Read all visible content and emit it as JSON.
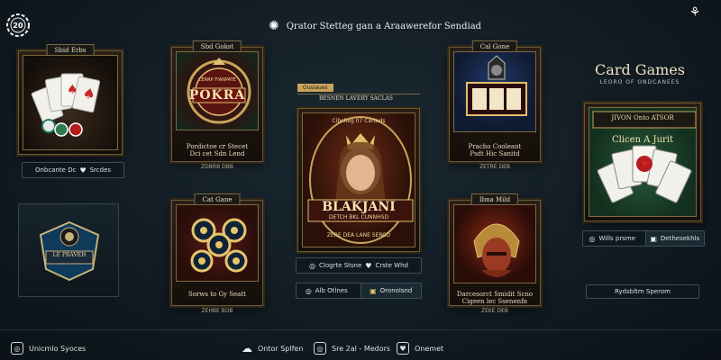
{
  "header": {
    "logo_badge_text": "20",
    "title": "Qrator Stetteg gan a Araawerefor Sendiad"
  },
  "cards_left": {
    "top": {
      "tag": "Sbid Erbs",
      "button_left": "Onbcante Dc",
      "button_right": "Srcdes"
    },
    "bottom": {
      "badge_text": "LE PRAVEH"
    }
  },
  "cards_col2": {
    "poker": {
      "tag": "Sbd Gokst",
      "title": "POKRA",
      "subtitle": "CERRP FIANPATE",
      "caption_line1": "Pordictoe cr Stecet",
      "caption_line2": "Dci cet Sdn Lend",
      "sub": "ZDBRB DBB"
    },
    "roulette": {
      "tag": "Cat Gane",
      "caption_line1": "Sorws to Gy Seatt",
      "caption_line2": "",
      "sub": "ZEHBE BOB"
    }
  },
  "cards_center": {
    "featured_tag": "Ousiaues",
    "featured_header": "BESNEN LAVERY SACLAS",
    "featured_title": "BLAKJANI",
    "featured_subtitle": "DETCH BKL CUNNHSD",
    "featured_sub2": "ZERE DEA LANE SERCO",
    "featured_caption": "Cibcheg 07 Carteds",
    "button1_left": "Clogrte Stsne",
    "button1_right": "Crste Whd",
    "button2_left": "Alb Otlnes",
    "button2_right": "Oronolsnd"
  },
  "cards_col4": {
    "slot": {
      "tag": "Cal Gone",
      "caption_line1": "Pracho Cooleant",
      "caption_line2": "Psdt Hic Sanitd",
      "sub": "ZETRE DEB"
    },
    "warrior": {
      "tag": "Ibna Mild",
      "caption_line1": "Darcesorct Smidit Scno",
      "caption_line2": "Cigeen lec Ssenenfn",
      "sub": "ZEKE DEB"
    }
  },
  "right_panel": {
    "title": "Card Games",
    "subtitle": "LEORO OF ONDCANEES",
    "card_banner": "JIVON Onto ATSOR",
    "card_overlay": "Clicen A Jurit",
    "button_left": "Wills prsme",
    "button_right": "Dethesekhls",
    "wide_button": "Rydsbltm Sperom"
  },
  "footer": {
    "left_label": "Unicmlo Syoces",
    "item1_label": "Ontor Splfen",
    "item2_label": "Sre 2al - Medors",
    "item3_label": "Onemet"
  },
  "colors": {
    "background": "#121c23",
    "gold_border": "#7d6a42",
    "pill_border": "#3f4d55"
  }
}
